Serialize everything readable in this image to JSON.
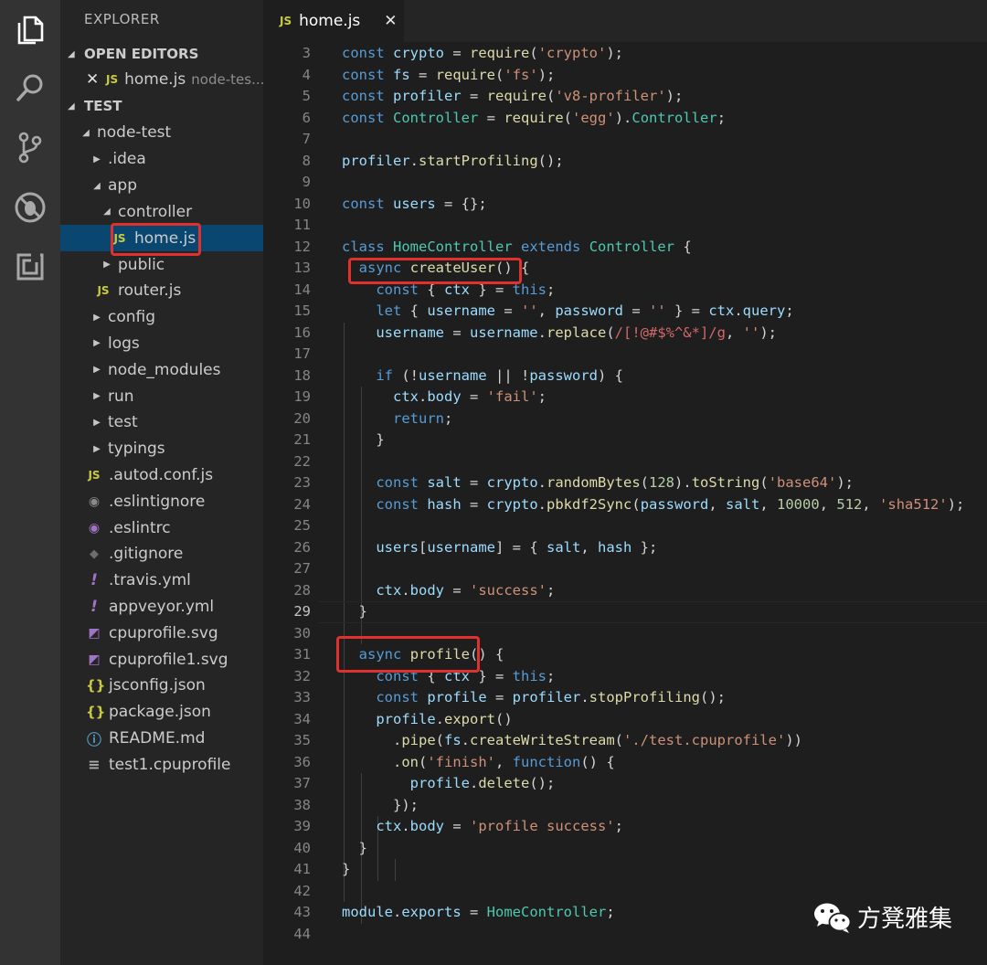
{
  "activity_bar": {
    "icons": [
      "files-icon",
      "search-icon",
      "source-control-icon",
      "debug-icon",
      "extensions-icon"
    ]
  },
  "sidebar": {
    "title": "EXPLORER",
    "open_editors": {
      "header": "OPEN EDITORS",
      "items": [
        {
          "name": "home.js",
          "path": "node-tes..."
        }
      ]
    },
    "workspace": {
      "header": "TEST",
      "tree": [
        {
          "label": "node-test"
        },
        {
          "label": ".idea"
        },
        {
          "label": "app"
        },
        {
          "label": "controller"
        },
        {
          "label": "home.js"
        },
        {
          "label": "public"
        },
        {
          "label": "router.js"
        },
        {
          "label": "config"
        },
        {
          "label": "logs"
        },
        {
          "label": "node_modules"
        },
        {
          "label": "run"
        },
        {
          "label": "test"
        },
        {
          "label": "typings"
        },
        {
          "label": ".autod.conf.js"
        },
        {
          "label": ".eslintignore"
        },
        {
          "label": ".eslintrc"
        },
        {
          "label": ".gitignore"
        },
        {
          "label": ".travis.yml"
        },
        {
          "label": "appveyor.yml"
        },
        {
          "label": "cpuprofile.svg"
        },
        {
          "label": "cpuprofile1.svg"
        },
        {
          "label": "jsconfig.json"
        },
        {
          "label": "package.json"
        },
        {
          "label": "README.md"
        },
        {
          "label": "test1.cpuprofile"
        }
      ]
    }
  },
  "tab": {
    "label": "home.js",
    "badge": "JS",
    "close": "✕"
  },
  "editor": {
    "line_numbers": [
      "3",
      "4",
      "5",
      "6",
      "7",
      "8",
      "9",
      "10",
      "11",
      "12",
      "13",
      "14",
      "15",
      "16",
      "17",
      "18",
      "19",
      "20",
      "21",
      "22",
      "23",
      "24",
      "25",
      "26",
      "27",
      "28",
      "29",
      "30",
      "31",
      "32",
      "33",
      "34",
      "35",
      "36",
      "37",
      "38",
      "39",
      "40",
      "41",
      "42",
      "43",
      "44"
    ],
    "current_line": "29",
    "lines": [
      "const crypto = require('crypto');",
      "const fs = require('fs');",
      "const profiler = require('v8-profiler');",
      "const Controller = require('egg').Controller;",
      "",
      "profiler.startProfiling();",
      "",
      "const users = {};",
      "",
      "class HomeController extends Controller {",
      "  async createUser() {",
      "    const { ctx } = this;",
      "    let { username = '', password = '' } = ctx.query;",
      "    username = username.replace(/[!@#$%^&*]/g, '');",
      "",
      "    if (!username || !password) {",
      "      ctx.body = 'fail';",
      "      return;",
      "    }",
      "",
      "    const salt = crypto.randomBytes(128).toString('base64');",
      "    const hash = crypto.pbkdf2Sync(password, salt, 10000, 512, 'sha512');",
      "",
      "    users[username] = { salt, hash };",
      "",
      "    ctx.body = 'success';",
      "  }",
      "",
      "  async profile() {",
      "    const { ctx } = this;",
      "    const profile = profiler.stopProfiling();",
      "    profile.export()",
      "      .pipe(fs.createWriteStream('./test.cpuprofile'))",
      "      .on('finish', function() {",
      "        profile.delete();",
      "      });",
      "    ctx.body = 'profile success';",
      "  }",
      "}",
      "",
      "module.exports = HomeController;",
      ""
    ]
  },
  "watermark": {
    "text": "方凳雅集"
  }
}
